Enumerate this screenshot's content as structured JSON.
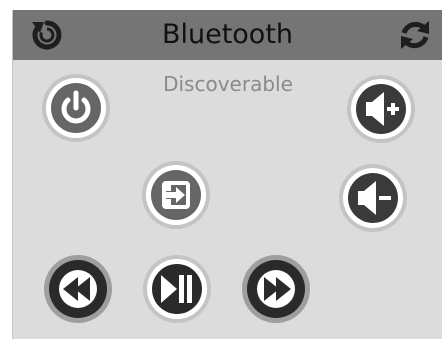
{
  "header": {
    "title": "Bluetooth",
    "left_icon": "refresh-icon",
    "right_icon": "sync-icon"
  },
  "status": {
    "text": "Discoverable"
  },
  "buttons": {
    "power": "power-icon",
    "source": "input-source-icon",
    "volume_up": "volume-up-icon",
    "volume_down": "volume-down-icon",
    "rewind": "rewind-icon",
    "play_pause": "play-pause-icon",
    "fast_forward": "fast-forward-icon"
  },
  "colors": {
    "panel_bg": "#dcdcdc",
    "titlebar_bg": "#757575",
    "icon_dark": "#3a3a3a",
    "icon_medium": "#666666",
    "subtitle": "#8a8a8a"
  }
}
